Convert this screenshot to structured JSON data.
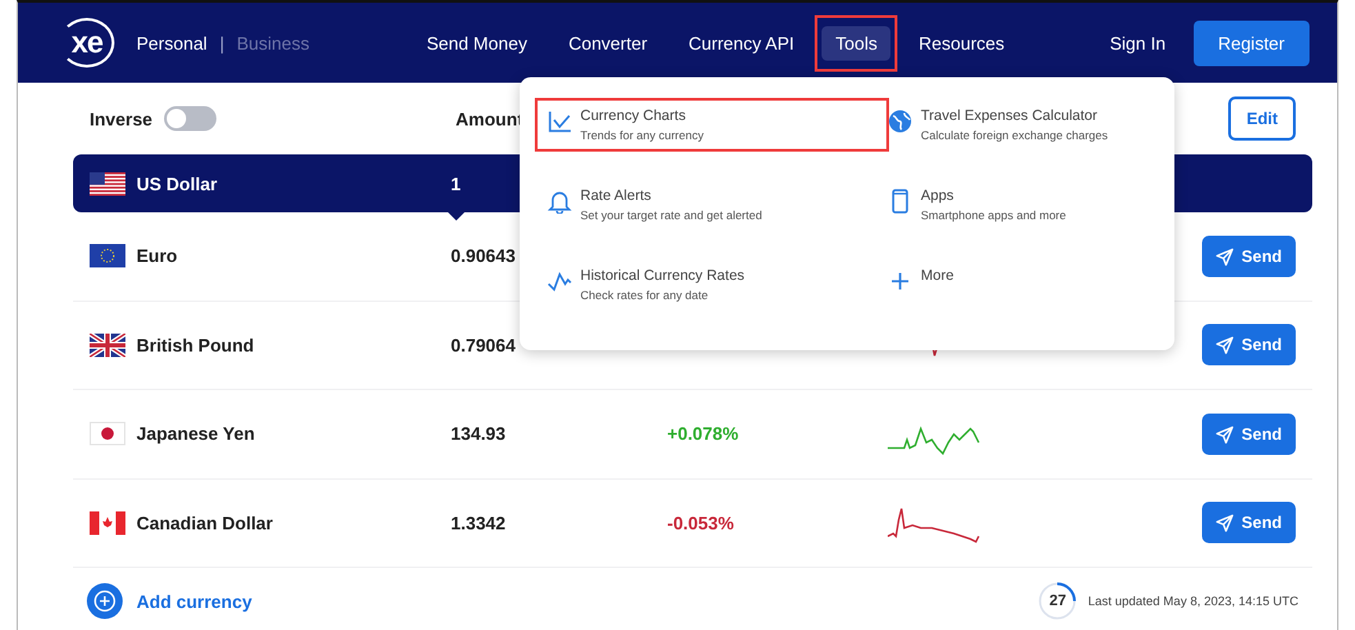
{
  "header": {
    "logo": "xe",
    "segments": [
      {
        "label": "Personal",
        "selected": true
      },
      {
        "label": "Business",
        "selected": false
      }
    ],
    "separator": "|",
    "nav": [
      {
        "label": "Send Money",
        "selected": false,
        "highlighted": false
      },
      {
        "label": "Converter",
        "selected": false,
        "highlighted": false
      },
      {
        "label": "Currency API",
        "selected": false,
        "highlighted": false
      },
      {
        "label": "Tools",
        "selected": true,
        "highlighted": true
      },
      {
        "label": "Resources",
        "selected": false,
        "highlighted": false
      }
    ],
    "sign_in": "Sign In",
    "register": "Register"
  },
  "toolbar": {
    "inverse_label": "Inverse",
    "inverse_on": false,
    "amount_label": "Amount",
    "edit": "Edit"
  },
  "base": {
    "name": "US Dollar",
    "amount": "1"
  },
  "rows": [
    {
      "name": "Euro",
      "amount": "0.90643",
      "send": "Send"
    },
    {
      "name": "British Pound",
      "amount": "0.79064",
      "kind": "down",
      "send": "Send"
    },
    {
      "name": "Japanese Yen",
      "amount": "134.93",
      "change": "+0.078%",
      "kind": "up",
      "send": "Send"
    },
    {
      "name": "Canadian Dollar",
      "amount": "1.3342",
      "change": "-0.053%",
      "kind": "down",
      "send": "Send"
    }
  ],
  "add_currency": "Add currency",
  "refresh_countdown": "27",
  "last_updated": "Last updated May 8, 2023, 14:15 UTC",
  "tools_menu": [
    {
      "title": "Currency Charts",
      "subtitle": "Trends for any currency",
      "highlighted": true
    },
    {
      "title": "Travel Expenses Calculator",
      "subtitle": "Calculate foreign exchange charges",
      "highlighted": false
    },
    {
      "title": "Rate Alerts",
      "subtitle": "Set your target rate and get alerted",
      "highlighted": false
    },
    {
      "title": "Apps",
      "subtitle": "Smartphone apps and more",
      "highlighted": false
    },
    {
      "title": "Historical Currency Rates",
      "subtitle": "Check rates for any date",
      "highlighted": false
    },
    {
      "title": "More",
      "highlighted": false
    }
  ]
}
